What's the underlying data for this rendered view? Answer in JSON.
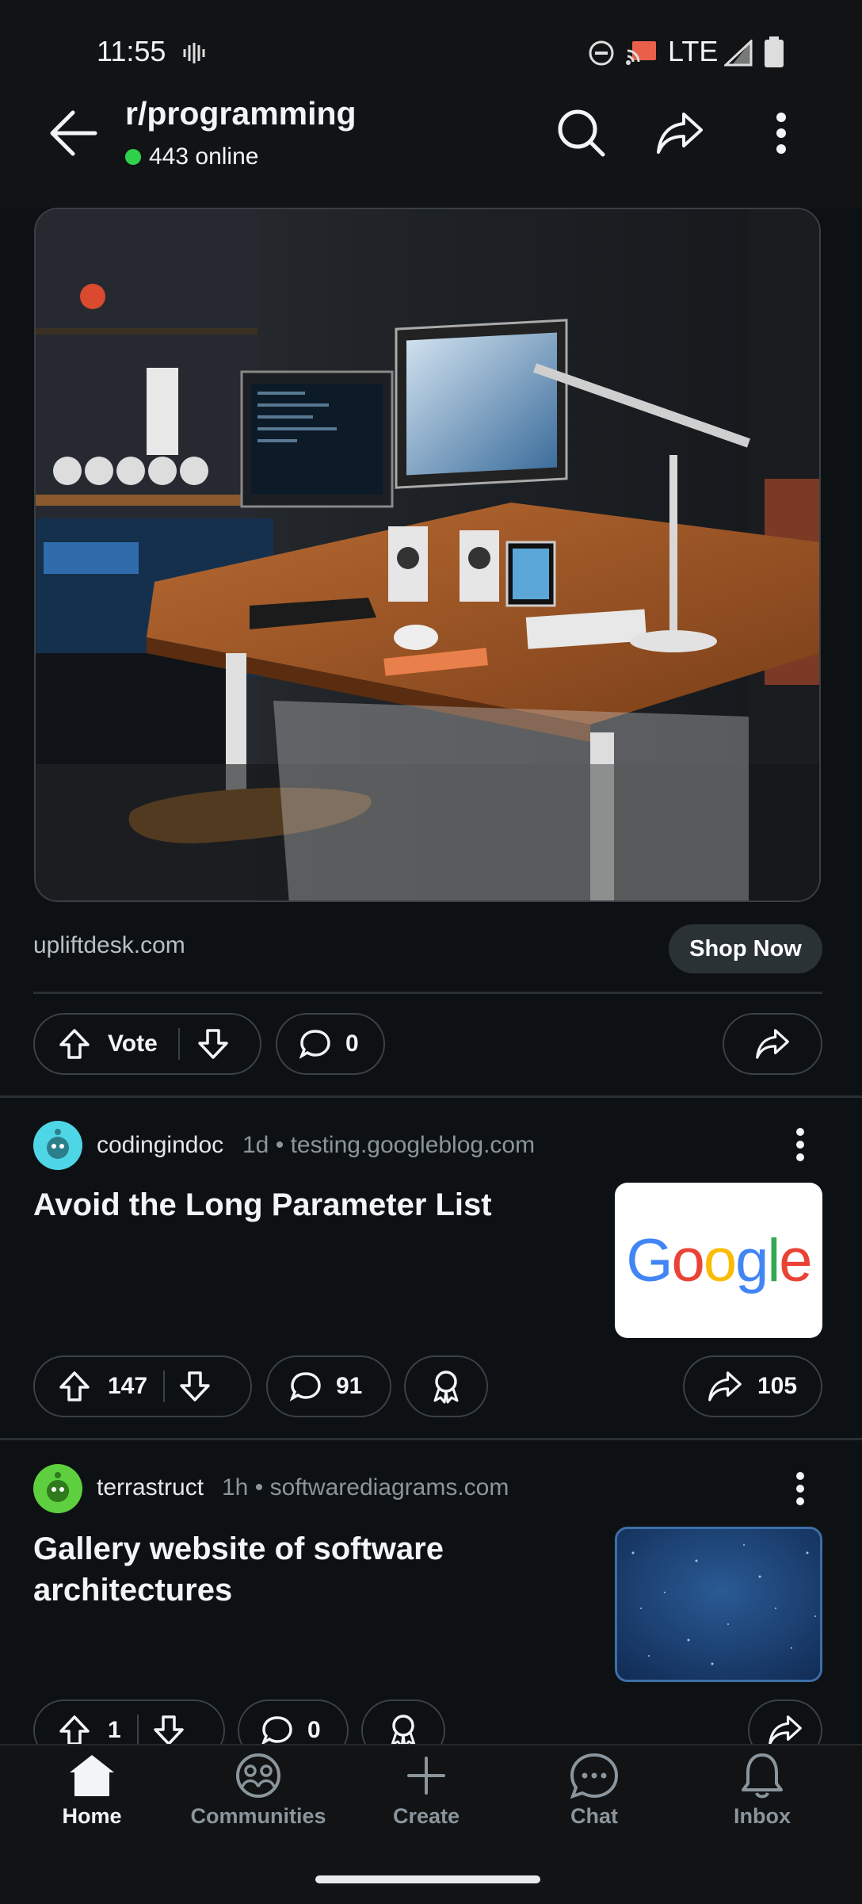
{
  "status_bar": {
    "time": "11:55",
    "network": "LTE"
  },
  "header": {
    "title": "r/programming",
    "online": "443 online"
  },
  "ad": {
    "domain": "upliftdesk.com",
    "cta": "Shop Now",
    "vote_label": "Vote",
    "comments": "0"
  },
  "posts": [
    {
      "author": "codingindoc",
      "age": "1d",
      "domain": "testing.googleblog.com",
      "title": "Avoid the Long Parameter List",
      "thumbnail_text": "Google",
      "upvotes": "147",
      "comments": "91",
      "shares": "105",
      "avatar_color": "#4fd6e6"
    },
    {
      "author": "terrastruct",
      "age": "1h",
      "domain": "softwarediagrams.com",
      "title": "Gallery website of software architectures",
      "upvotes": "1",
      "comments": "0",
      "avatar_color": "#5ecf3f"
    }
  ],
  "nav": {
    "items": [
      {
        "label": "Home",
        "icon": "home-icon",
        "active": true
      },
      {
        "label": "Communities",
        "icon": "communities-icon"
      },
      {
        "label": "Create",
        "icon": "plus-icon"
      },
      {
        "label": "Chat",
        "icon": "chat-icon"
      },
      {
        "label": "Inbox",
        "icon": "bell-icon"
      }
    ]
  },
  "colors": {
    "background": "#0e1113",
    "online": "#2fd14b",
    "pill_border": "#3a4147"
  }
}
